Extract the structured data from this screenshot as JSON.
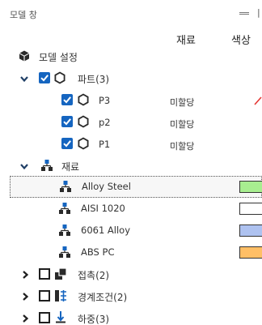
{
  "panel": {
    "title": "모델 창",
    "columns": {
      "material": "재료",
      "color": "색상"
    }
  },
  "colors": {
    "checkbox_checked": "#1565c0",
    "material_icon": "#1565c0",
    "selected_outline": "#555555",
    "note_mark": "#e53935"
  },
  "tree": {
    "model_settings": {
      "label": "모델 설정",
      "icon": "model-cube-icon"
    },
    "parts": {
      "label": "파트(3)",
      "expanded": true,
      "checked": true,
      "icon": "hexagon-part-icon",
      "items": [
        {
          "name": "P3",
          "material": "미할당",
          "checked": true
        },
        {
          "name": "p2",
          "material": "미할당",
          "checked": true
        },
        {
          "name": "P1",
          "material": "미할당",
          "checked": true
        }
      ]
    },
    "materials": {
      "label": "재료",
      "expanded": true,
      "icon": "material-tree-icon",
      "items": [
        {
          "name": "Alloy Steel",
          "color": "#a8ee90",
          "selected": true
        },
        {
          "name": "AISI 1020",
          "color": "#ffffff",
          "selected": false
        },
        {
          "name": "6061 Alloy",
          "color": "#aec2f0",
          "selected": false
        },
        {
          "name": "ABS PC",
          "color": "#ffbf66",
          "selected": false
        }
      ]
    },
    "contacts": {
      "label": "접촉(2)",
      "icon": "contact-icon",
      "expanded": false,
      "checked": false
    },
    "boundary_conditions": {
      "label": "경계조건(2)",
      "icon": "boundary-condition-icon",
      "expanded": false,
      "checked": false
    },
    "loads": {
      "label": "하중(3)",
      "icon": "load-icon",
      "expanded": false,
      "checked": false
    }
  }
}
